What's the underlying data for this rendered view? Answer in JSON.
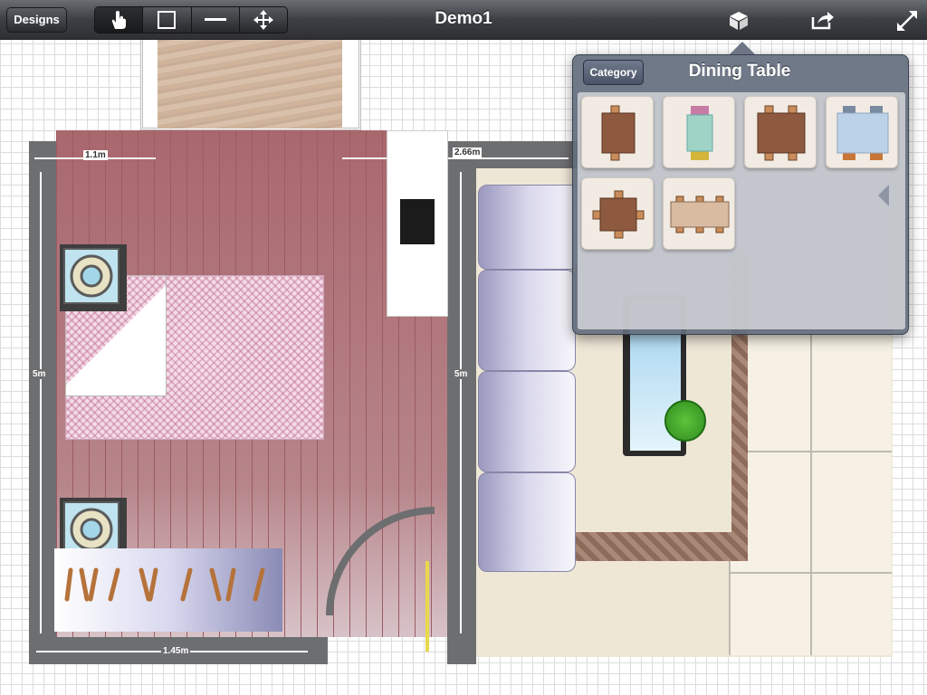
{
  "toolbar": {
    "designs_label": "Designs",
    "title": "Demo1",
    "tools": [
      "hand-tool-icon",
      "rectangle-tool-icon",
      "line-tool-icon",
      "move-tool-icon"
    ],
    "right_icons": [
      "cube-icon",
      "share-icon",
      "fullscreen-icon"
    ]
  },
  "floorplan": {
    "dimensions": {
      "top_left": "1.1m",
      "top_right": "2.66m",
      "left": "5m",
      "middle": "5m",
      "bottom": "1.45m"
    }
  },
  "popover": {
    "category_label": "Category",
    "title": "Dining Table",
    "items": [
      {
        "name": "square-wood-table-4-chairs"
      },
      {
        "name": "round-glass-table-2-chairs"
      },
      {
        "name": "rect-wood-table-4-chairs"
      },
      {
        "name": "glass-table-4-chairs"
      },
      {
        "name": "square-wood-table-chairs-sides"
      },
      {
        "name": "long-wood-table-6-chairs"
      }
    ]
  },
  "colors": {
    "toolbar_bg": "#3c3f44",
    "wall": "#6d6e70",
    "popover_bg": "#646e7d"
  }
}
